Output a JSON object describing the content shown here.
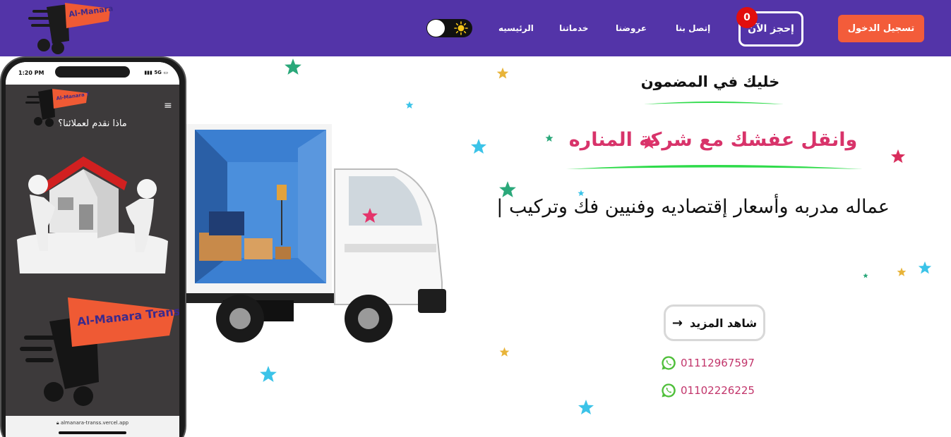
{
  "navbar": {
    "logo_text": "Al-Manara Trans",
    "login_label": "تسجيل الدخول",
    "book_label": "إحجز الآن",
    "cart_count": "0",
    "links": [
      "إتصل بنا",
      "عروضنا",
      "خدماتنا",
      "الرئيسيه"
    ]
  },
  "phone": {
    "time": "1:20 PM",
    "network": "5G",
    "heading": "ماذا نقدم لعملائنا؟",
    "logo_text": "Al-Manara Trans",
    "url": "almanara-transs.vercel.app"
  },
  "hero": {
    "subtitle": "خليك في المضمون",
    "headline": "وانقل عفشك مع شركة المناره",
    "description": "عماله مدربه وأسعار إقتصاديه وفنيين فك وتركيب |",
    "more_label": "شاهد المزيد",
    "phones": [
      "01112967597",
      "01102226225"
    ]
  },
  "colors": {
    "navbar": "#5334a8",
    "login": "#f35c3a",
    "headline": "#d8336a",
    "phone_number": "#c2356b",
    "underline": "#2edb4a",
    "whatsapp": "#4fbf3a"
  },
  "icons": {
    "sun": "sun-icon",
    "arrow": "arrow-right-icon",
    "whatsapp": "whatsapp-icon",
    "menu": "hamburger-icon",
    "lock": "lock-icon"
  }
}
